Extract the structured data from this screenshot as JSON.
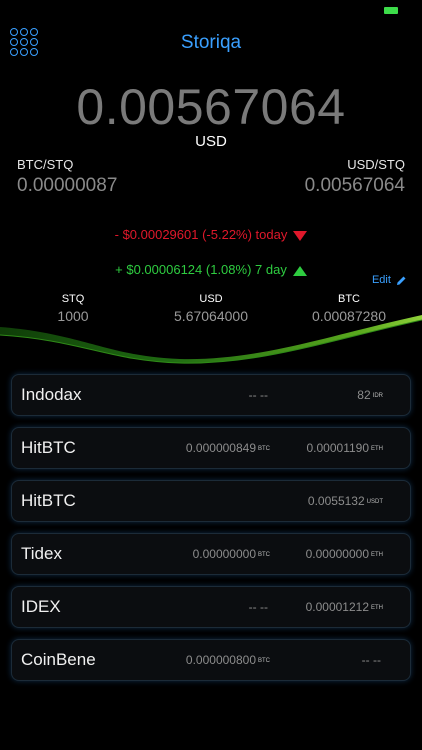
{
  "header": {
    "title": "Storiqa"
  },
  "price": {
    "value": "0.00567064",
    "currency": "USD"
  },
  "pairs": {
    "left": {
      "label": "BTC/STQ",
      "value": "0.00000087"
    },
    "right": {
      "label": "USD/STQ",
      "value": "0.00567064"
    }
  },
  "changes": {
    "today": "- $0.00029601 (-5.22%) today",
    "week": "+ $0.00006124 (1.08%) 7 day",
    "colors": {
      "down": "#e0182b",
      "up": "#2ecc40"
    }
  },
  "edit_label": "Edit",
  "holdings": [
    {
      "label": "STQ",
      "value": "1000"
    },
    {
      "label": "USD",
      "value": "5.67064000"
    },
    {
      "label": "BTC",
      "value": "0.00087280"
    }
  ],
  "exchanges": [
    {
      "name": "Indodax",
      "p1": "-- --",
      "u1": "",
      "p2": "82",
      "u2": "IDR"
    },
    {
      "name": "HitBTC",
      "p1": "0.000000849",
      "u1": "BTC",
      "p2": "0.00001190",
      "u2": "ETH"
    },
    {
      "name": "HitBTC",
      "p1": "",
      "u1": "",
      "p2": "0.0055132",
      "u2": "USDT"
    },
    {
      "name": "Tidex",
      "p1": "0.00000000",
      "u1": "BTC",
      "p2": "0.00000000",
      "u2": "ETH"
    },
    {
      "name": "IDEX",
      "p1": "-- --",
      "u1": "",
      "p2": "0.00001212",
      "u2": "ETH"
    },
    {
      "name": "CoinBene",
      "p1": "0.000000800",
      "u1": "BTC",
      "p2": "-- --",
      "u2": ""
    }
  ],
  "colors": {
    "accent": "#3aa0ff"
  }
}
